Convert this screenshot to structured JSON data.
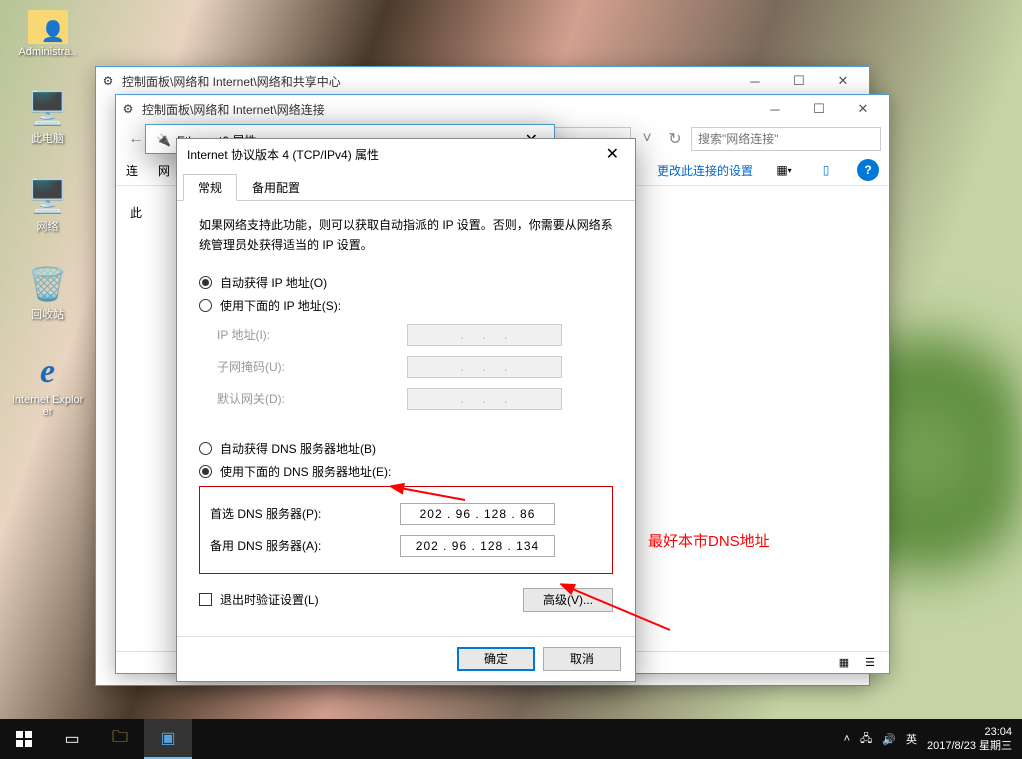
{
  "desktop": {
    "icons": [
      {
        "label": "Administra..",
        "glyph": "👤"
      },
      {
        "label": "此电脑",
        "glyph": "🖥️"
      },
      {
        "label": "网络",
        "glyph": "🖥️"
      },
      {
        "label": "回收站",
        "glyph": "🗑️"
      },
      {
        "label": "Internet Explorer",
        "glyph": "e"
      }
    ]
  },
  "window1": {
    "title": "控制面板\\网络和 Internet\\网络和共享中心"
  },
  "window2": {
    "title": "控制面板\\网络和 Internet\\网络连接",
    "search_placeholder": "搜索\"网络连接\"",
    "toolbar_left": "连",
    "toolbar_net": "网",
    "toolbar_link": "更改此连接的设置",
    "sublabel": "此"
  },
  "ethernet_dialog": {
    "title": "Ethernet0 属性"
  },
  "dialog": {
    "title": "Internet 协议版本 4 (TCP/IPv4) 属性",
    "tabs": [
      "常规",
      "备用配置"
    ],
    "description": "如果网络支持此功能，则可以获取自动指派的 IP 设置。否则，你需要从网络系统管理员处获得适当的 IP 设置。",
    "ip_auto": "自动获得 IP 地址(O)",
    "ip_manual": "使用下面的 IP 地址(S):",
    "ip_label": "IP 地址(I):",
    "subnet_label": "子网掩码(U):",
    "gateway_label": "默认网关(D):",
    "dns_auto": "自动获得 DNS 服务器地址(B)",
    "dns_manual": "使用下面的 DNS 服务器地址(E):",
    "dns_primary_label": "首选 DNS 服务器(P):",
    "dns_primary_value": "202 . 96 . 128 . 86",
    "dns_alt_label": "备用 DNS 服务器(A):",
    "dns_alt_value": "202 . 96 . 128 . 134",
    "exit_verify": "退出时验证设置(L)",
    "advanced": "高级(V)...",
    "ok": "确定",
    "cancel": "取消"
  },
  "annotation": {
    "text": "最好本市DNS地址"
  },
  "taskbar": {
    "ime": "英",
    "time": "23:04",
    "date": "2017/8/23 星期三"
  }
}
